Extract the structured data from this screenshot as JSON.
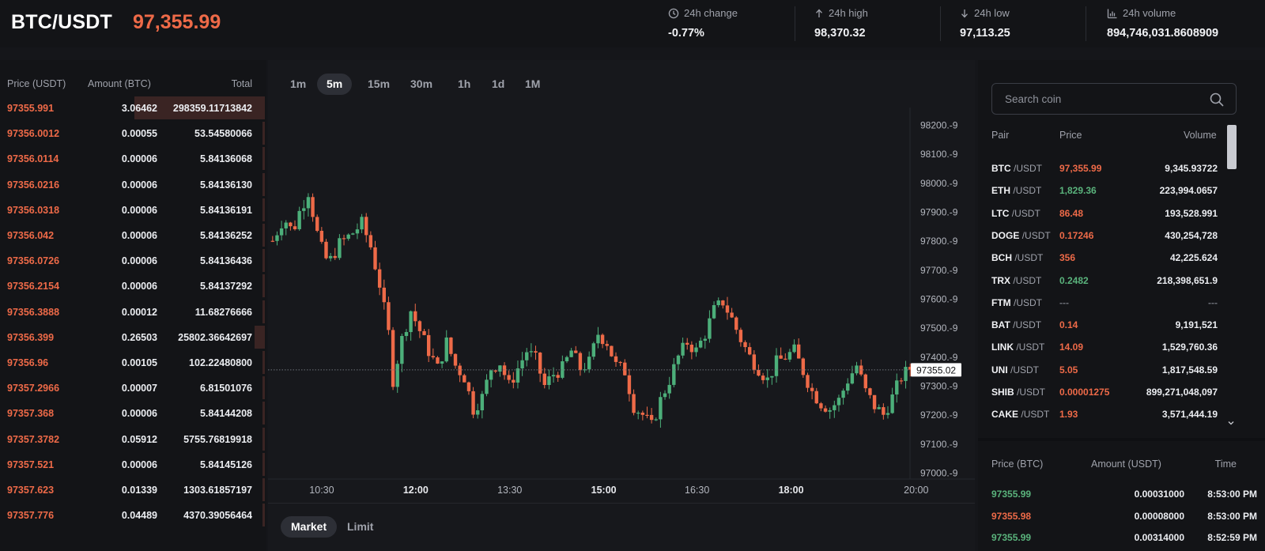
{
  "header": {
    "pair": "BTC/USDT",
    "last_price": "97,355.99",
    "stats": [
      {
        "label": "24h change",
        "value": "-0.77%",
        "icon": "clock-icon",
        "color": "#ee6a48"
      },
      {
        "label": "24h high",
        "value": "98,370.32",
        "icon": "arrow-up-icon",
        "color": "#f1f2f5"
      },
      {
        "label": "24h low",
        "value": "97,113.25",
        "icon": "arrow-down-icon",
        "color": "#f1f2f5"
      },
      {
        "label": "24h volume",
        "value": "894,746,031.8608909",
        "icon": "bar-chart-icon",
        "color": "#f1f2f5"
      }
    ]
  },
  "orderbook": {
    "headers": {
      "price": "Price (USDT)",
      "amount": "Amount (BTC)",
      "total": "Total"
    },
    "rows": [
      {
        "price": "97355.991",
        "amount": "3.06462",
        "total": "298359.11713842",
        "depth": 0.5
      },
      {
        "price": "97356.0012",
        "amount": "0.00055",
        "total": "53.54580066",
        "depth": 0
      },
      {
        "price": "97356.0114",
        "amount": "0.00006",
        "total": "5.84136068",
        "depth": 0
      },
      {
        "price": "97356.0216",
        "amount": "0.00006",
        "total": "5.84136130",
        "depth": 0
      },
      {
        "price": "97356.0318",
        "amount": "0.00006",
        "total": "5.84136191",
        "depth": 0
      },
      {
        "price": "97356.042",
        "amount": "0.00006",
        "total": "5.84136252",
        "depth": 0
      },
      {
        "price": "97356.0726",
        "amount": "0.00006",
        "total": "5.84136436",
        "depth": 0
      },
      {
        "price": "97356.2154",
        "amount": "0.00006",
        "total": "5.84137292",
        "depth": 0
      },
      {
        "price": "97356.3888",
        "amount": "0.00012",
        "total": "11.68276666",
        "depth": 0
      },
      {
        "price": "97356.399",
        "amount": "0.26503",
        "total": "25802.36642697",
        "depth": 0.04
      },
      {
        "price": "97356.96",
        "amount": "0.00105",
        "total": "102.22480800",
        "depth": 0
      },
      {
        "price": "97357.2966",
        "amount": "0.00007",
        "total": "6.81501076",
        "depth": 0
      },
      {
        "price": "97357.368",
        "amount": "0.00006",
        "total": "5.84144208",
        "depth": 0
      },
      {
        "price": "97357.3782",
        "amount": "0.05912",
        "total": "5755.76819918",
        "depth": 0
      },
      {
        "price": "97357.521",
        "amount": "0.00006",
        "total": "5.84145126",
        "depth": 0
      },
      {
        "price": "97357.623",
        "amount": "0.01339",
        "total": "1303.61857197",
        "depth": 0
      },
      {
        "price": "97357.776",
        "amount": "0.04489",
        "total": "4370.39056464",
        "depth": 0
      }
    ]
  },
  "timeframes": {
    "items": [
      "1m",
      "5m",
      "15m",
      "30m",
      "1h",
      "1d",
      "1M"
    ],
    "active": "5m"
  },
  "chart": {
    "y_ticks": [
      "98200.-9",
      "98100.-9",
      "98000.-9",
      "97900.-9",
      "97800.-9",
      "97700.-9",
      "97600.-9",
      "97500.-9",
      "97400.-9",
      "97300.-9",
      "97200.-9",
      "97100.-9",
      "97000.-9"
    ],
    "y_range": [
      97000,
      98200
    ],
    "x_ticks": [
      {
        "label": "10:30",
        "bold": false,
        "frac": 0.076
      },
      {
        "label": "12:00",
        "bold": true,
        "frac": 0.209
      },
      {
        "label": "13:30",
        "bold": false,
        "frac": 0.342
      },
      {
        "label": "15:00",
        "bold": true,
        "frac": 0.475
      },
      {
        "label": "16:30",
        "bold": false,
        "frac": 0.607
      },
      {
        "label": "18:00",
        "bold": true,
        "frac": 0.74
      },
      {
        "label": "20:00",
        "bold": false,
        "frac": 0.917
      }
    ],
    "current_price_label": "97355.02",
    "current_price": 97355.02,
    "up_color": "#4caf7a",
    "down_color": "#ee6a48"
  },
  "order_tabs": {
    "items": [
      "Market",
      "Limit"
    ],
    "active": "Market"
  },
  "markets": {
    "search_placeholder": "Search coin",
    "headers": {
      "pair": "Pair",
      "price": "Price",
      "volume": "Volume"
    },
    "rows": [
      {
        "base": "BTC",
        "quote": "/USDT",
        "price": "97,355.99",
        "volume": "9,345.93722",
        "color": "#ee6a48"
      },
      {
        "base": "ETH",
        "quote": "/USDT",
        "price": "1,829.36",
        "volume": "223,994.0657",
        "color": "#5ab37c"
      },
      {
        "base": "LTC",
        "quote": "/USDT",
        "price": "86.48",
        "volume": "193,528.991",
        "color": "#ee6a48"
      },
      {
        "base": "DOGE",
        "quote": "/USDT",
        "price": "0.17246",
        "volume": "430,254,728",
        "color": "#ee6a48"
      },
      {
        "base": "BCH",
        "quote": "/USDT",
        "price": "356",
        "volume": "42,225.624",
        "color": "#ee6a48"
      },
      {
        "base": "TRX",
        "quote": "/USDT",
        "price": "0.2482",
        "volume": "218,398,651.9",
        "color": "#5ab37c"
      },
      {
        "base": "FTM",
        "quote": "/USDT",
        "price": "---",
        "volume": "---",
        "color": "#6f727a"
      },
      {
        "base": "BAT",
        "quote": "/USDT",
        "price": "0.14",
        "volume": "9,191,521",
        "color": "#ee6a48"
      },
      {
        "base": "LINK",
        "quote": "/USDT",
        "price": "14.09",
        "volume": "1,529,760.36",
        "color": "#ee6a48"
      },
      {
        "base": "UNI",
        "quote": "/USDT",
        "price": "5.05",
        "volume": "1,817,548.59",
        "color": "#ee6a48"
      },
      {
        "base": "SHIB",
        "quote": "/USDT",
        "price": "0.00001275",
        "volume": "899,271,048,097",
        "color": "#ee6a48"
      },
      {
        "base": "CAKE",
        "quote": "/USDT",
        "price": "1.93",
        "volume": "3,571,444.19",
        "color": "#ee6a48"
      }
    ]
  },
  "trades": {
    "headers": {
      "price": "Price (BTC)",
      "amount": "Amount (USDT)",
      "time": "Time"
    },
    "rows": [
      {
        "price": "97355.99",
        "amount": "0.00031000",
        "time": "8:53:00 PM",
        "color": "#5ab37c"
      },
      {
        "price": "97355.98",
        "amount": "0.00008000",
        "time": "8:53:00 PM",
        "color": "#ee6a48"
      },
      {
        "price": "97355.99",
        "amount": "0.00314000",
        "time": "8:52:59 PM",
        "color": "#5ab37c"
      }
    ]
  }
}
